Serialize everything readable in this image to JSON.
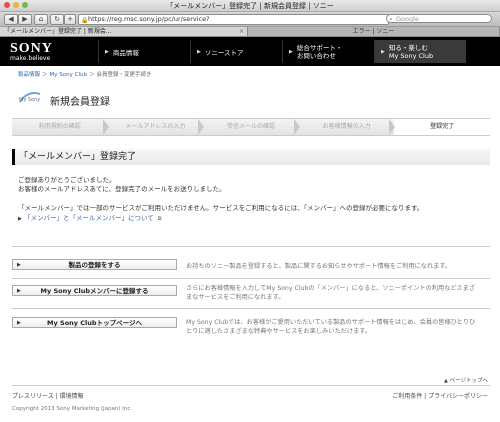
{
  "browser": {
    "window_title": "「メールメンバー」登録完了 | 新規会員登録 | ソニー",
    "url": "https://reg.msc.sony.jp/pc/ur/service?",
    "search_placeholder": "Google",
    "tabs": [
      {
        "label": "「メールメンバー」登録完了 | 新規会..."
      },
      {
        "label": "エラー | ソニー"
      }
    ]
  },
  "header": {
    "logo": "SONY",
    "tagline": "make.believe",
    "nav": [
      {
        "label": "商品情報"
      },
      {
        "label": "ソニーストア"
      },
      {
        "label_line1": "総合サポート・",
        "label_line2": "お問い合わせ"
      },
      {
        "label_line1": "知る・楽しむ",
        "label_line2": "My Sony Club"
      }
    ]
  },
  "breadcrumb": [
    "製品情報",
    "My Sony Club",
    "会員登録・変更手続き"
  ],
  "page": {
    "logo_text": "My Sony",
    "title": "新規会員登録",
    "steps": [
      "利用規約の確認",
      "メールアドレスの入力",
      "受信メールの確認",
      "お客様情報の入力",
      "登録完了"
    ],
    "section_title": "「メールメンバー」登録完了",
    "para1_line1": "ご登録ありがとうございました。",
    "para1_line2": "お客様のメールアドレスあてに、登録完了のメールをお送りしました。",
    "para2": "「メールメンバー」では一部のサービスがご利用いただけません。サービスをご利用になるには、「メンバー」への登録が必要になります。",
    "info_link": "「メンバー」と「メールメンバー」について"
  },
  "actions": [
    {
      "label": "製品の登録をする",
      "desc_line1": "お持ちのソニー製品を登録すると、製品に関するお知らせやサポート情報をご利用になれます。",
      "desc_line2": ""
    },
    {
      "label": "My Sony Clubメンバーに登録する",
      "desc_line1": "さらにお客様情報を入力してMy Sony Clubの「メンバー」になると、ソニーポイントの利用などさまざ",
      "desc_line2": "まなサービスをご利用になれます。"
    },
    {
      "label": "My Sony Clubトップページへ",
      "desc_line1": "My Sony Clubでは、お客様がご愛用いただいている製品のサポート情報をはじめ、会員の皆様ひとりひ",
      "desc_line2": "とりに適したさまざまな特典やサービスをお楽しみいただけます。"
    }
  ],
  "footer": {
    "page_top": "ページトップへ",
    "left_links": [
      "プレスリリース",
      "環境情報"
    ],
    "right_links": [
      "ご利用条件",
      "プライバシーポリシー"
    ],
    "copyright": "Copyright 2013 Sony Marketing (Japan) Inc."
  },
  "colors": {
    "accent": "#000000",
    "link": "#3366aa"
  }
}
